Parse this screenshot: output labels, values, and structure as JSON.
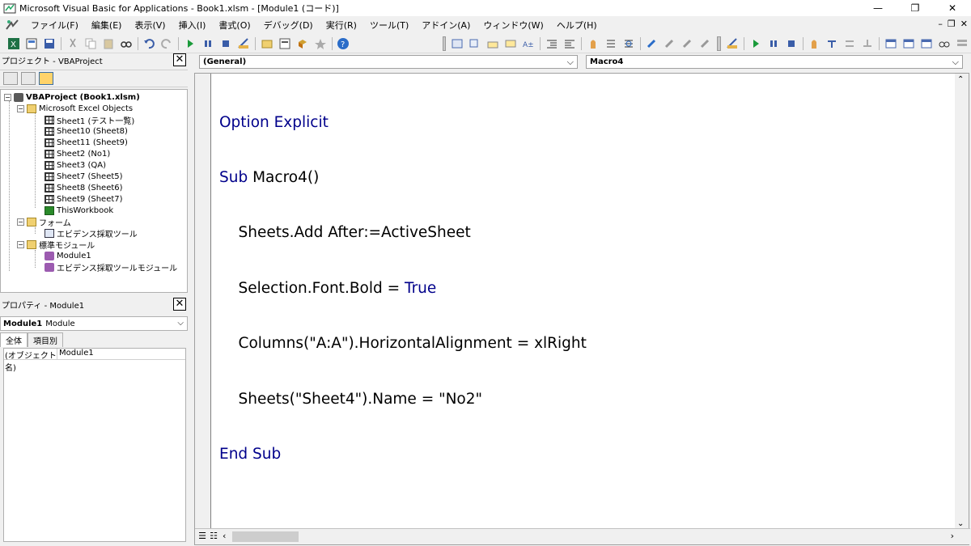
{
  "titlebar": {
    "title": "Microsoft Visual Basic for Applications - Book1.xlsm - [Module1 (コード)]",
    "minimize": "—",
    "restore": "❐",
    "close": "✕"
  },
  "menubar": {
    "items": [
      "ファイル(F)",
      "編集(E)",
      "表示(V)",
      "挿入(I)",
      "書式(O)",
      "デバッグ(D)",
      "実行(R)",
      "ツール(T)",
      "アドイン(A)",
      "ウィンドウ(W)",
      "ヘルプ(H)"
    ],
    "mdi_minimize": "–",
    "mdi_restore": "❐",
    "mdi_close": "✕"
  },
  "project_pane": {
    "title": "プロジェクト - VBAProject",
    "close": "✕",
    "tree": {
      "root": "VBAProject (Book1.xlsm)",
      "excel_objects_folder": "Microsoft Excel Objects",
      "excel_objects": [
        "Sheet1 (テスト一覧)",
        "Sheet10 (Sheet8)",
        "Sheet11 (Sheet9)",
        "Sheet2 (No1)",
        "Sheet3 (QA)",
        "Sheet7 (Sheet5)",
        "Sheet8 (Sheet6)",
        "Sheet9 (Sheet7)",
        "ThisWorkbook"
      ],
      "forms_folder": "フォーム",
      "forms": [
        "エビデンス採取ツール"
      ],
      "modules_folder": "標準モジュール",
      "modules": [
        "Module1",
        "エビデンス採取ツールモジュール"
      ]
    }
  },
  "properties_pane": {
    "title": "プロパティ - Module1",
    "close": "✕",
    "object_bold": "Module1",
    "object_type": "Module",
    "tab_all": "全体",
    "tab_category": "項目別",
    "rows": [
      {
        "name": "(オブジェクト名)",
        "value": "Module1"
      }
    ]
  },
  "code_window": {
    "object_combo": "(General)",
    "proc_combo": "Macro4",
    "lines": [
      {
        "kw": "Option Explicit",
        "text": ""
      },
      {
        "kw": "Sub",
        "text": " Macro4()"
      },
      {
        "kw": "",
        "text": "    Sheets.Add After:=ActiveSheet"
      },
      {
        "kw": "",
        "text": "    Selection.Font.Bold = ",
        "kw2": "True"
      },
      {
        "kw": "",
        "text": "    Columns(\"A:A\").HorizontalAlignment = xlRight"
      },
      {
        "kw": "",
        "text": "    Sheets(\"Sheet4\").Name = \"No2\""
      },
      {
        "kw": "End Sub",
        "text": ""
      }
    ]
  },
  "colors": {
    "keyword": "#00008b",
    "window_bg": "#f0f0f0",
    "code_bg": "#ffffff"
  }
}
